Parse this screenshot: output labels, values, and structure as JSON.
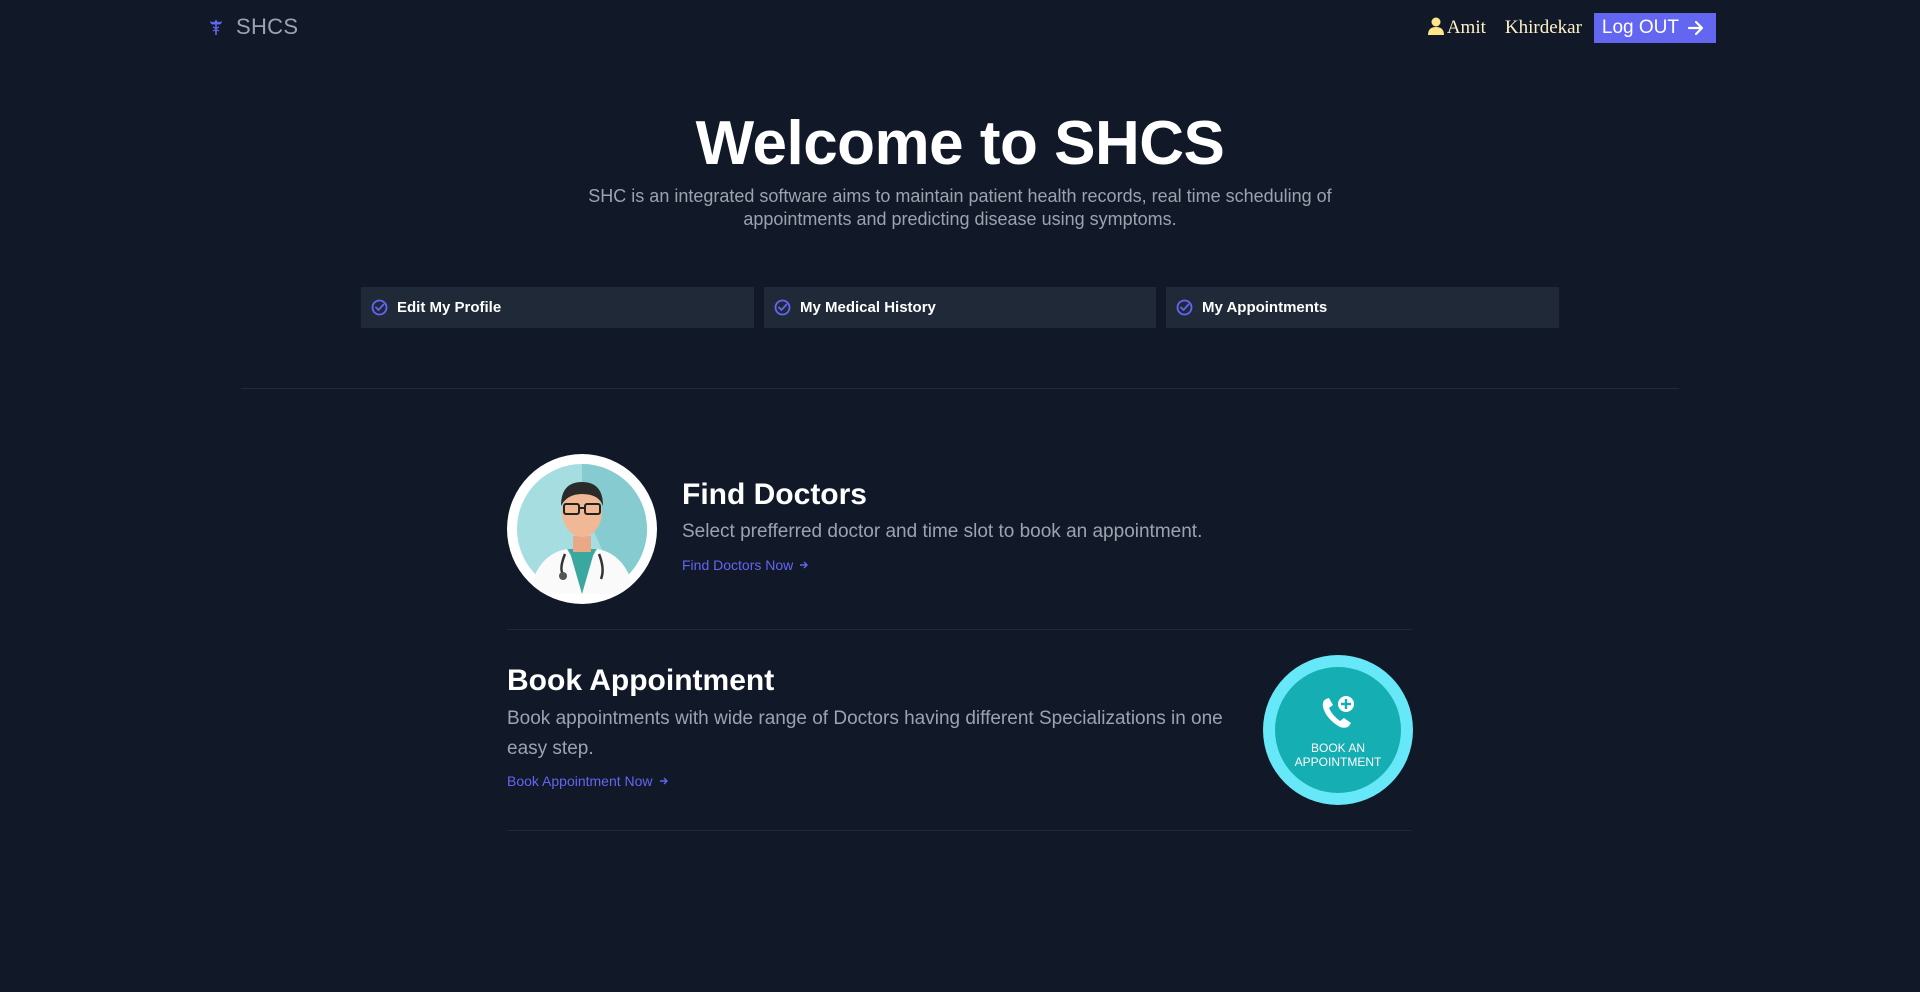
{
  "header": {
    "brand": "SHCS",
    "user_first": "Amit",
    "user_last": "Khirdekar",
    "logout_label": "Log OUT"
  },
  "hero": {
    "title": "Welcome to SHCS",
    "description": "SHC is an integrated software aims to maintain patient health records, real time scheduling of appointments and predicting disease using symptoms."
  },
  "quick_links": [
    {
      "label": "Edit My Profile"
    },
    {
      "label": "My Medical History"
    },
    {
      "label": "My Appointments"
    }
  ],
  "find_doctors": {
    "title": "Find Doctors",
    "description": "Select prefferred doctor and time slot to book an appointment.",
    "link": "Find Doctors Now"
  },
  "book_appointment": {
    "title": "Book Appointment",
    "description": "Book appointments with wide range of Doctors having different Specializations in one easy step.",
    "link": "Book Appointment Now",
    "badge_line1": "BOOK AN",
    "badge_line2": "APPOINTMENT"
  },
  "colors": {
    "background": "#111827",
    "accent": "#6366f1",
    "card": "#1f2937",
    "teal": "#14aeb3"
  }
}
